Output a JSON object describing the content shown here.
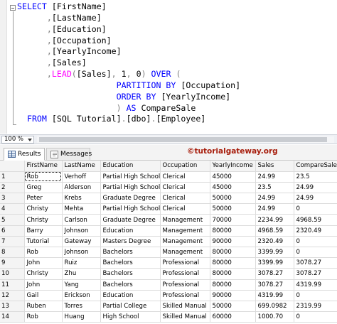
{
  "editor": {
    "lines": [
      [
        {
          "c": "kw",
          "t": "SELECT "
        },
        {
          "c": "tx",
          "t": "[FirstName]"
        }
      ],
      [
        {
          "c": "tx",
          "t": "      "
        },
        {
          "c": "gr",
          "t": ","
        },
        {
          "c": "tx",
          "t": "[LastName]"
        }
      ],
      [
        {
          "c": "tx",
          "t": "      "
        },
        {
          "c": "gr",
          "t": ","
        },
        {
          "c": "tx",
          "t": "[Education]"
        }
      ],
      [
        {
          "c": "tx",
          "t": "      "
        },
        {
          "c": "gr",
          "t": ","
        },
        {
          "c": "tx",
          "t": "[Occupation]"
        }
      ],
      [
        {
          "c": "tx",
          "t": "      "
        },
        {
          "c": "gr",
          "t": ","
        },
        {
          "c": "tx",
          "t": "[YearlyIncome]"
        }
      ],
      [
        {
          "c": "tx",
          "t": "      "
        },
        {
          "c": "gr",
          "t": ","
        },
        {
          "c": "tx",
          "t": "[Sales]"
        }
      ],
      [
        {
          "c": "tx",
          "t": "      "
        },
        {
          "c": "gr",
          "t": ","
        },
        {
          "c": "fn",
          "t": "LEAD"
        },
        {
          "c": "gr",
          "t": "("
        },
        {
          "c": "tx",
          "t": "[Sales]"
        },
        {
          "c": "gr",
          "t": ", "
        },
        {
          "c": "tx",
          "t": "1"
        },
        {
          "c": "gr",
          "t": ", "
        },
        {
          "c": "tx",
          "t": "0"
        },
        {
          "c": "gr",
          "t": ") "
        },
        {
          "c": "kw",
          "t": "OVER "
        },
        {
          "c": "gr",
          "t": "("
        }
      ],
      [
        {
          "c": "tx",
          "t": "                    "
        },
        {
          "c": "kw",
          "t": "PARTITION BY "
        },
        {
          "c": "tx",
          "t": "[Occupation]"
        }
      ],
      [
        {
          "c": "tx",
          "t": "                    "
        },
        {
          "c": "kw",
          "t": "ORDER BY "
        },
        {
          "c": "tx",
          "t": "[YearlyIncome]"
        }
      ],
      [
        {
          "c": "tx",
          "t": "                    "
        },
        {
          "c": "gr",
          "t": ") "
        },
        {
          "c": "kw",
          "t": "AS "
        },
        {
          "c": "tx",
          "t": "CompareSale"
        }
      ],
      [
        {
          "c": "tx",
          "t": "  "
        },
        {
          "c": "kw",
          "t": "FROM "
        },
        {
          "c": "tx",
          "t": "[SQL Tutorial]"
        },
        {
          "c": "gr",
          "t": "."
        },
        {
          "c": "tx",
          "t": "[dbo]"
        },
        {
          "c": "gr",
          "t": "."
        },
        {
          "c": "tx",
          "t": "[Employee]"
        }
      ]
    ]
  },
  "zoom": {
    "value": "100 %"
  },
  "tabs": {
    "results": "Results",
    "messages": "Messages"
  },
  "watermark": "©tutorialgateway.org",
  "grid": {
    "columns": [
      "FirstName",
      "LastName",
      "Education",
      "Occupation",
      "YearlyIncome",
      "Sales",
      "CompareSale"
    ],
    "rows": [
      [
        "1",
        "Rob",
        "Verhoff",
        "Partial High School",
        "Clerical",
        "45000",
        "24.99",
        "23.5"
      ],
      [
        "2",
        "Greg",
        "Alderson",
        "Partial High School",
        "Clerical",
        "45000",
        "23.5",
        "24.99"
      ],
      [
        "3",
        "Peter",
        "Krebs",
        "Graduate Degree",
        "Clerical",
        "50000",
        "24.99",
        "24.99"
      ],
      [
        "4",
        "Christy",
        "Mehta",
        "Partial High School",
        "Clerical",
        "50000",
        "24.99",
        "0"
      ],
      [
        "5",
        "Christy",
        "Carlson",
        "Graduate Degree",
        "Management",
        "70000",
        "2234.99",
        "4968.59"
      ],
      [
        "6",
        "Barry",
        "Johnson",
        "Education",
        "Management",
        "80000",
        "4968.59",
        "2320.49"
      ],
      [
        "7",
        "Tutorial",
        "Gateway",
        "Masters Degree",
        "Management",
        "90000",
        "2320.49",
        "0"
      ],
      [
        "8",
        "Rob",
        "Johnson",
        "Bachelors",
        "Management",
        "80000",
        "3399.99",
        "0"
      ],
      [
        "9",
        "John",
        "Ruiz",
        "Bachelors",
        "Professional",
        "80000",
        "3399.99",
        "3078.27"
      ],
      [
        "10",
        "Christy",
        "Zhu",
        "Bachelors",
        "Professional",
        "80000",
        "3078.27",
        "3078.27"
      ],
      [
        "11",
        "John",
        "Yang",
        "Bachelors",
        "Professional",
        "80000",
        "3078.27",
        "4319.99"
      ],
      [
        "12",
        "Gail",
        "Erickson",
        "Education",
        "Professional",
        "90000",
        "4319.99",
        "0"
      ],
      [
        "13",
        "Ruben",
        "Torres",
        "Partial College",
        "Skilled Manual",
        "50000",
        "699.0982",
        "2319.99"
      ],
      [
        "14",
        "Rob",
        "Huang",
        "High School",
        "Skilled Manual",
        "60000",
        "1000.70",
        "0"
      ]
    ]
  }
}
